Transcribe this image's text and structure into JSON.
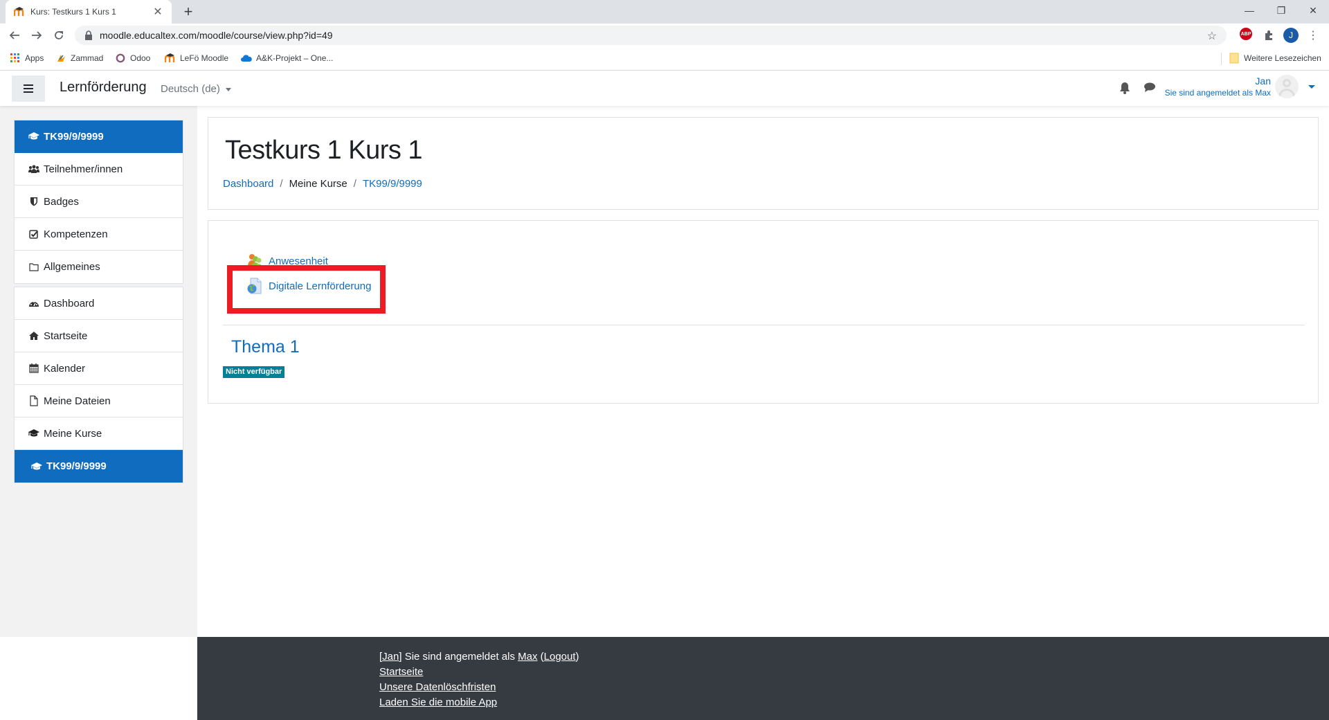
{
  "browser": {
    "tab_title": "Kurs: Testkurs 1 Kurs 1",
    "new_tab_label": "+",
    "url": "moodle.educaltex.com/moodle/course/view.php?id=49",
    "bookmarks": [
      {
        "label": "Apps",
        "icon": "apps-grid-icon"
      },
      {
        "label": "Zammad",
        "icon": "zammad-icon"
      },
      {
        "label": "Odoo",
        "icon": "odoo-icon"
      },
      {
        "label": "LeFö Moodle",
        "icon": "moodle-icon"
      },
      {
        "label": "A&K-Projekt – One...",
        "icon": "onedrive-icon"
      }
    ],
    "other_bookmarks": "Weitere Lesezeichen",
    "extensions": {
      "adblock": "ABP",
      "profile_initial": "J"
    }
  },
  "navbar": {
    "brand": "Lernförderung",
    "language": "Deutsch (de)",
    "user_name": "Jan",
    "user_sub": "Sie sind angemeldet als Max"
  },
  "sidebar": {
    "group1": [
      {
        "label": "TK99/9/9999",
        "icon": "graduation-cap-icon",
        "active": true
      },
      {
        "label": "Teilnehmer/innen",
        "icon": "users-icon"
      },
      {
        "label": "Badges",
        "icon": "shield-icon"
      },
      {
        "label": "Kompetenzen",
        "icon": "checkbox-icon"
      },
      {
        "label": "Allgemeines",
        "icon": "folder-icon"
      }
    ],
    "group2": [
      {
        "label": "Dashboard",
        "icon": "dashboard-icon"
      },
      {
        "label": "Startseite",
        "icon": "home-icon"
      },
      {
        "label": "Kalender",
        "icon": "calendar-icon"
      },
      {
        "label": "Meine Dateien",
        "icon": "file-icon"
      },
      {
        "label": "Meine Kurse",
        "icon": "graduation-cap-icon"
      },
      {
        "label": "TK99/9/9999",
        "icon": "graduation-cap-icon",
        "active": true
      }
    ]
  },
  "header": {
    "title": "Testkurs 1 Kurs 1",
    "breadcrumb": [
      "Dashboard",
      "Meine Kurse",
      "TK99/9/9999"
    ],
    "breadcrumb_sep": "/"
  },
  "course": {
    "activities": [
      {
        "label": "Anwesenheit",
        "icon": "attendance-icon"
      },
      {
        "label": "Digitale Lernförderung",
        "icon": "url-globe-icon",
        "highlighted": true
      }
    ],
    "section_title": "Thema 1",
    "section_badge": "Nicht verfügbar"
  },
  "footer": {
    "login_prefix": "[",
    "login_user": "Jan",
    "login_mid": "] Sie sind angemeldet als ",
    "login_as": "Max",
    "login_open": " (",
    "logout": "Logout",
    "login_close": ")",
    "links": [
      "Startseite",
      "Unsere Datenlöschfristen",
      "Laden Sie die mobile App"
    ]
  },
  "colors": {
    "primary": "#0f6cbf",
    "badge": "#008196",
    "highlight": "#ed1c24",
    "footer": "#363a41"
  }
}
